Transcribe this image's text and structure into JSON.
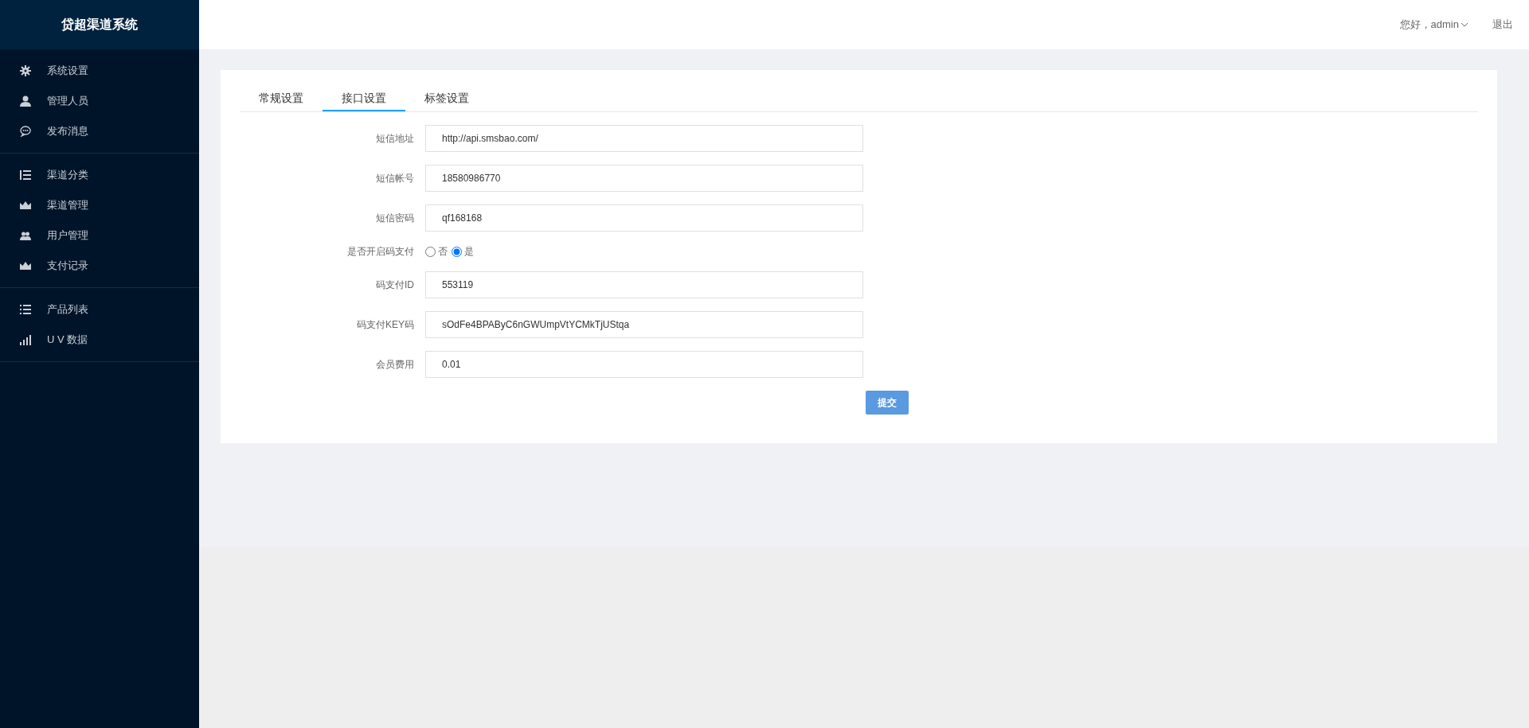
{
  "sidebar": {
    "title": "贷超渠道系统",
    "groups": [
      {
        "items": [
          {
            "label": "系统设置"
          },
          {
            "label": "管理人员"
          },
          {
            "label": "发布消息"
          }
        ]
      },
      {
        "items": [
          {
            "label": "渠道分类"
          },
          {
            "label": "渠道管理"
          },
          {
            "label": "用户管理"
          },
          {
            "label": "支付记录"
          }
        ]
      },
      {
        "items": [
          {
            "label": "产品列表"
          },
          {
            "label": "U V 数据"
          }
        ]
      }
    ]
  },
  "header": {
    "greeting": "您好，admin",
    "logout": "退出"
  },
  "tabs": [
    {
      "label": "常规设置",
      "selected": false
    },
    {
      "label": "接口设置",
      "selected": true
    },
    {
      "label": "标签设置",
      "selected": false
    }
  ],
  "form": {
    "fields": [
      {
        "kind": "text",
        "label": "短信地址",
        "value": "http://api.smsbao.com/"
      },
      {
        "kind": "text",
        "label": "短信帐号",
        "value": "18580986770"
      },
      {
        "kind": "text",
        "label": "短信密码",
        "value": "qf168168"
      },
      {
        "kind": "radio",
        "label": "是否开启码支付",
        "options": [
          {
            "label": "否",
            "selected": false
          },
          {
            "label": "是",
            "selected": true
          }
        ]
      },
      {
        "kind": "text",
        "label": "码支付ID",
        "value": "553119"
      },
      {
        "kind": "text",
        "label": "码支付KEY码",
        "value": "sOdFe4BPAByC6nGWUmpVtYCMkTjUStqa"
      },
      {
        "kind": "text",
        "label": "会员费用",
        "value": "0.01"
      }
    ],
    "submit": "提交"
  }
}
